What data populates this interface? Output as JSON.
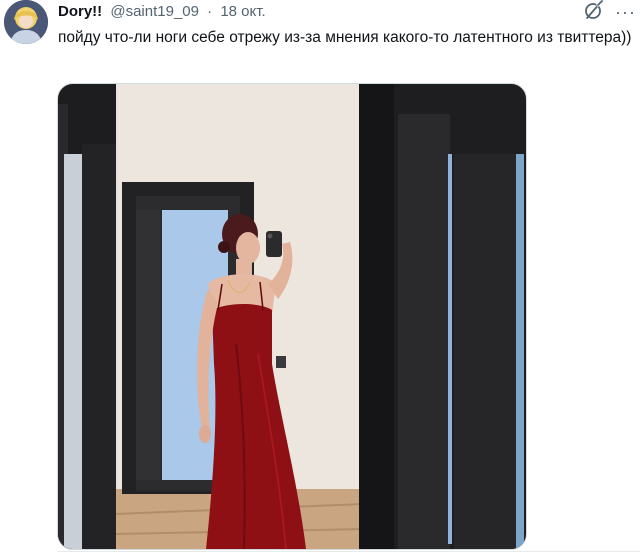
{
  "tweet": {
    "author_name": "Dory!!",
    "handle": "@saint19_09",
    "separator": "·",
    "date": "18 окт.",
    "text": "пойду что-ли ноги себе отрежу из-за мнения какого-то латентного из твиттера))"
  },
  "icons": {
    "grok": "grok-icon",
    "more": "more-icon",
    "more_glyph": "···"
  },
  "colors": {
    "secondary_text": "#536471",
    "dress": "#8e0f14"
  }
}
